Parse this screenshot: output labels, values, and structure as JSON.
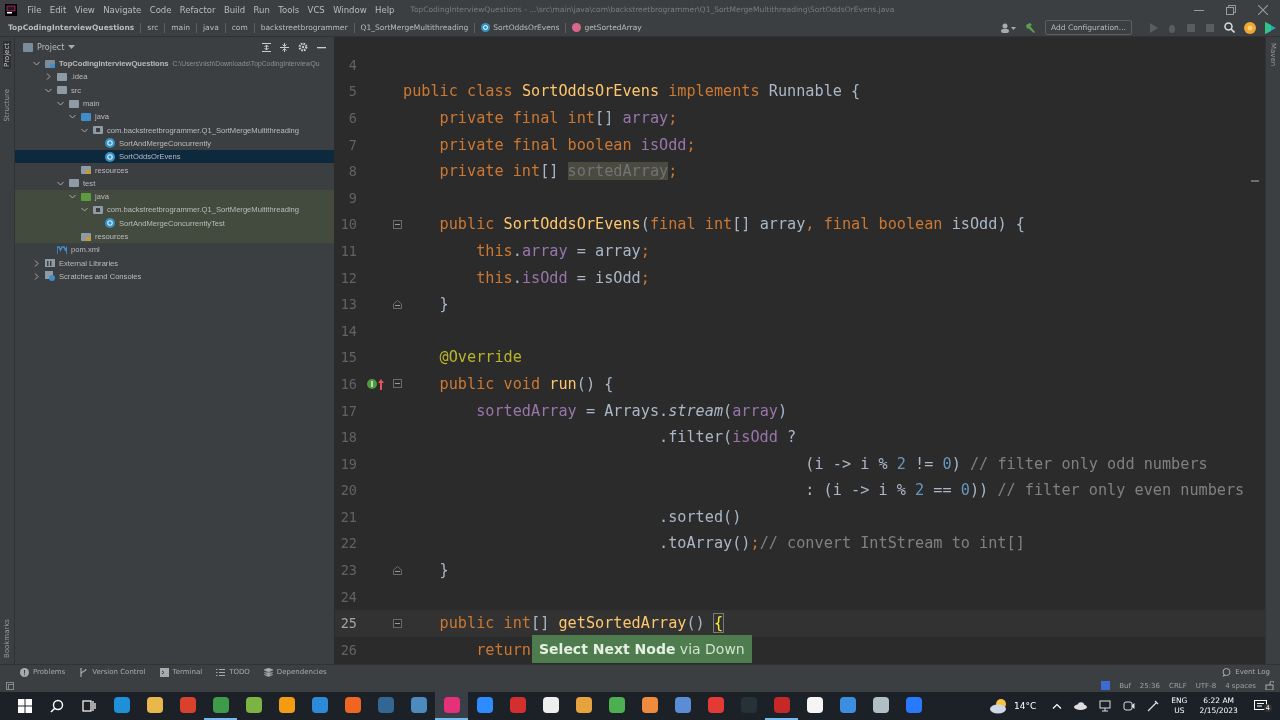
{
  "menu": [
    "File",
    "Edit",
    "View",
    "Navigate",
    "Code",
    "Refactor",
    "Build",
    "Run",
    "Tools",
    "VCS",
    "Window",
    "Help"
  ],
  "window": {
    "title": "TopCodingInterviewQuestions - ...\\src\\main\\java\\com\\backstreetbrogrammer\\Q1_SortMergeMultithreading\\SortOddsOrEvens.java"
  },
  "breadcrumbs": [
    {
      "label": "TopCodingInterviewQuestions",
      "kind": "project"
    },
    {
      "label": "src",
      "kind": "folder"
    },
    {
      "label": "main",
      "kind": "folder"
    },
    {
      "label": "java",
      "kind": "folder"
    },
    {
      "label": "com",
      "kind": "folder"
    },
    {
      "label": "backstreetbrogrammer",
      "kind": "folder"
    },
    {
      "label": "Q1_SortMergeMultithreading",
      "kind": "folder"
    },
    {
      "label": "SortOddsOrEvens",
      "kind": "class"
    },
    {
      "label": "getSortedArray",
      "kind": "method"
    }
  ],
  "toolbar": {
    "run_config": "Add Configuration..."
  },
  "side_tabs": {
    "left_top": [
      {
        "label": "Project",
        "selected": true
      },
      {
        "label": "Structure",
        "selected": false
      }
    ],
    "left_bottom": [
      {
        "label": "Bookmarks",
        "selected": false
      }
    ],
    "right": [
      {
        "label": "Maven",
        "selected": false
      }
    ]
  },
  "project_panel": {
    "title": "Project",
    "tree": [
      {
        "label": "TopCodingInterviewQuestions",
        "path": "C:\\Users\\nish\\Downloads\\TopCodingInterviewQu",
        "kind": "module",
        "expanded": true,
        "selected": false,
        "highlighted": false,
        "children": [
          {
            "label": ".idea",
            "kind": "folder",
            "expanded": false,
            "selected": false,
            "highlighted": false
          },
          {
            "label": "src",
            "kind": "folder",
            "expanded": true,
            "selected": false,
            "highlighted": false,
            "children": [
              {
                "label": "main",
                "kind": "folder",
                "expanded": true,
                "selected": false,
                "highlighted": false,
                "children": [
                  {
                    "label": "java",
                    "kind": "source",
                    "expanded": true,
                    "selected": false,
                    "highlighted": false,
                    "children": [
                      {
                        "label": "com.backstreetbrogrammer.Q1_SortMergeMultithreading",
                        "kind": "package",
                        "expanded": true,
                        "selected": false,
                        "highlighted": false,
                        "children": [
                          {
                            "label": "SortAndMergeConcurrently",
                            "kind": "class",
                            "selected": false,
                            "highlighted": false
                          },
                          {
                            "label": "SortOddsOrEvens",
                            "kind": "class",
                            "selected": true,
                            "highlighted": false
                          }
                        ]
                      }
                    ]
                  },
                  {
                    "label": "resources",
                    "kind": "resources",
                    "selected": false,
                    "highlighted": false
                  }
                ]
              },
              {
                "label": "test",
                "kind": "folder",
                "expanded": true,
                "selected": false,
                "highlighted": false,
                "children": [
                  {
                    "label": "java",
                    "kind": "test-source",
                    "expanded": true,
                    "selected": false,
                    "highlighted": true,
                    "children": [
                      {
                        "label": "com.backstreetbrogrammer.Q1_SortMergeMultithreading",
                        "kind": "package",
                        "expanded": true,
                        "selected": false,
                        "highlighted": true,
                        "children": [
                          {
                            "label": "SortAndMergeConcurrentlyTest",
                            "kind": "class",
                            "selected": false,
                            "highlighted": true
                          }
                        ]
                      }
                    ]
                  },
                  {
                    "label": "resources",
                    "kind": "resources",
                    "selected": false,
                    "highlighted": true
                  }
                ]
              }
            ]
          },
          {
            "label": "pom.xml",
            "kind": "maven",
            "selected": false,
            "highlighted": false
          }
        ]
      },
      {
        "label": "External Libraries",
        "kind": "library",
        "expanded": false,
        "selected": false,
        "highlighted": false
      },
      {
        "label": "Scratches and Consoles",
        "kind": "scratches",
        "expanded": false,
        "selected": false,
        "highlighted": false
      }
    ]
  },
  "editor": {
    "lines": [
      {
        "number": "4",
        "current": false,
        "override": false
      },
      {
        "number": "5",
        "current": false,
        "override": false,
        "tokens": [
          {
            "kind": "keyword",
            "text": "public class "
          },
          {
            "kind": "declaration",
            "text": "SortOddsOrEvens "
          },
          {
            "kind": "keyword",
            "text": "implements "
          },
          {
            "kind": "plain",
            "text": "Runnable {"
          }
        ]
      },
      {
        "number": "6",
        "current": false,
        "override": false,
        "tokens": [
          {
            "kind": "keyword",
            "text": "    private final int"
          },
          {
            "kind": "plain",
            "text": "[] "
          },
          {
            "kind": "field",
            "text": "array"
          },
          {
            "kind": "keyword",
            "text": ";"
          }
        ]
      },
      {
        "number": "7",
        "current": false,
        "override": false,
        "tokens": [
          {
            "kind": "keyword",
            "text": "    private final boolean "
          },
          {
            "kind": "field",
            "text": "isOdd"
          },
          {
            "kind": "keyword",
            "text": ";"
          }
        ]
      },
      {
        "number": "8",
        "current": false,
        "override": false,
        "tokens": [
          {
            "kind": "keyword",
            "text": "    private int"
          },
          {
            "kind": "plain",
            "text": "[] "
          },
          {
            "kind": "unused",
            "text": "sortedArray"
          },
          {
            "kind": "keyword",
            "text": ";"
          }
        ]
      },
      {
        "number": "9",
        "current": false,
        "override": false
      },
      {
        "number": "10",
        "current": false,
        "override": false,
        "fold_start": true,
        "tokens": [
          {
            "kind": "keyword",
            "text": "    public "
          },
          {
            "kind": "declaration",
            "text": "SortOddsOrEvens"
          },
          {
            "kind": "plain",
            "text": "("
          },
          {
            "kind": "keyword",
            "text": "final int"
          },
          {
            "kind": "plain",
            "text": "[] array"
          },
          {
            "kind": "keyword",
            "text": ", final boolean "
          },
          {
            "kind": "plain",
            "text": "isOdd) {"
          }
        ]
      },
      {
        "number": "11",
        "current": false,
        "override": false,
        "tokens": [
          {
            "kind": "keyword",
            "text": "        this"
          },
          {
            "kind": "plain",
            "text": "."
          },
          {
            "kind": "field",
            "text": "array"
          },
          {
            "kind": "plain",
            "text": " = array"
          },
          {
            "kind": "keyword",
            "text": ";"
          }
        ]
      },
      {
        "number": "12",
        "current": false,
        "override": false,
        "tokens": [
          {
            "kind": "keyword",
            "text": "        this"
          },
          {
            "kind": "plain",
            "text": "."
          },
          {
            "kind": "field",
            "text": "isOdd"
          },
          {
            "kind": "plain",
            "text": " = isOdd"
          },
          {
            "kind": "keyword",
            "text": ";"
          }
        ]
      },
      {
        "number": "13",
        "current": false,
        "override": false,
        "fold_end": true,
        "tokens": [
          {
            "kind": "plain",
            "text": "    }"
          }
        ]
      },
      {
        "number": "14",
        "current": false,
        "override": false
      },
      {
        "number": "15",
        "current": false,
        "override": false,
        "tokens": [
          {
            "kind": "annotation",
            "text": "    @Override"
          }
        ]
      },
      {
        "number": "16",
        "current": false,
        "override": true,
        "fold_start": true,
        "tokens": [
          {
            "kind": "keyword",
            "text": "    public void "
          },
          {
            "kind": "declaration",
            "text": "run"
          },
          {
            "kind": "plain",
            "text": "() {"
          }
        ]
      },
      {
        "number": "17",
        "current": false,
        "override": false,
        "tokens": [
          {
            "kind": "field",
            "text": "        sortedArray"
          },
          {
            "kind": "plain",
            "text": " = Arrays."
          },
          {
            "kind": "static",
            "text": "stream"
          },
          {
            "kind": "plain",
            "text": "("
          },
          {
            "kind": "field",
            "text": "array"
          },
          {
            "kind": "plain",
            "text": ")"
          }
        ]
      },
      {
        "number": "18",
        "current": false,
        "override": false,
        "tokens": [
          {
            "kind": "plain",
            "text": "                            .filter("
          },
          {
            "kind": "field",
            "text": "isOdd"
          },
          {
            "kind": "plain",
            "text": " ?"
          }
        ]
      },
      {
        "number": "19",
        "current": false,
        "override": false,
        "tokens": [
          {
            "kind": "plain",
            "text": "                                            (i -> i % "
          },
          {
            "kind": "number",
            "text": "2"
          },
          {
            "kind": "plain",
            "text": " != "
          },
          {
            "kind": "number",
            "text": "0"
          },
          {
            "kind": "plain",
            "text": ") "
          },
          {
            "kind": "comment",
            "text": "// filter only odd numbers"
          }
        ]
      },
      {
        "number": "20",
        "current": false,
        "override": false,
        "tokens": [
          {
            "kind": "plain",
            "text": "                                            : (i -> i % "
          },
          {
            "kind": "number",
            "text": "2"
          },
          {
            "kind": "plain",
            "text": " == "
          },
          {
            "kind": "number",
            "text": "0"
          },
          {
            "kind": "plain",
            "text": ")) "
          },
          {
            "kind": "comment",
            "text": "// filter only even numbers"
          }
        ]
      },
      {
        "number": "21",
        "current": false,
        "override": false,
        "tokens": [
          {
            "kind": "plain",
            "text": "                            .sorted()"
          }
        ]
      },
      {
        "number": "22",
        "current": false,
        "override": false,
        "tokens": [
          {
            "kind": "plain",
            "text": "                            .toArray()"
          },
          {
            "kind": "keyword",
            "text": ";"
          },
          {
            "kind": "comment",
            "text": "// convert IntStream to int[]"
          }
        ]
      },
      {
        "number": "23",
        "current": false,
        "override": false,
        "fold_end": true,
        "tokens": [
          {
            "kind": "plain",
            "text": "    }"
          }
        ]
      },
      {
        "number": "24",
        "current": false,
        "override": false
      },
      {
        "number": "25",
        "current": true,
        "override": false,
        "fold_start": true,
        "tokens": [
          {
            "kind": "keyword",
            "text": "    public int"
          },
          {
            "kind": "plain",
            "text": "[] "
          },
          {
            "kind": "declaration",
            "text": "getSortedArray"
          },
          {
            "kind": "plain",
            "text": "() "
          },
          {
            "kind": "brace",
            "text": "{"
          }
        ]
      },
      {
        "number": "26",
        "current": false,
        "override": false,
        "tokens": [
          {
            "kind": "keyword",
            "text": "        return"
          }
        ]
      }
    ],
    "tooltip": "**Select Next Node** via Down"
  },
  "tool_tabs": [
    {
      "label": "Problems",
      "kind": "problems"
    },
    {
      "label": "Version Control",
      "kind": "vcs"
    },
    {
      "label": "Terminal",
      "kind": "terminal"
    },
    {
      "label": "TODO",
      "kind": "todo"
    },
    {
      "label": "Dependencies",
      "kind": "deps"
    }
  ],
  "event_log": "Event Log",
  "status_bar": [
    "Buf",
    "25:36",
    "CRLF",
    "UTF-8",
    "4 spaces"
  ],
  "taskbar": {
    "apps": [
      {
        "color": "#1f8fd8",
        "selected": false,
        "running": false
      },
      {
        "color": "#e8b84a",
        "selected": false,
        "running": false
      },
      {
        "color": "#d9412c",
        "selected": false,
        "running": false
      },
      {
        "color": "#3e9b4a",
        "selected": false,
        "running": true
      },
      {
        "color": "#7cb342",
        "selected": false,
        "running": false
      },
      {
        "color": "#f39c12",
        "selected": false,
        "running": false
      },
      {
        "color": "#2d8ad8",
        "selected": false,
        "running": false
      },
      {
        "color": "#f06522",
        "selected": false,
        "running": false
      },
      {
        "color": "#336791",
        "selected": false,
        "running": false
      },
      {
        "color": "#4b8bbe",
        "selected": false,
        "running": false
      },
      {
        "color": "#e5317a",
        "selected": true,
        "running": true
      },
      {
        "color": "#2d8cff",
        "selected": false,
        "running": false
      },
      {
        "color": "#d32f2f",
        "selected": false,
        "running": false
      },
      {
        "color": "#eeeeee",
        "selected": false,
        "running": false
      },
      {
        "color": "#e6a23c",
        "selected": false,
        "running": false
      },
      {
        "color": "#4caf50",
        "selected": false,
        "running": false
      },
      {
        "color": "#f08a3c",
        "selected": false,
        "running": false
      },
      {
        "color": "#5b8dd6",
        "selected": false,
        "running": false
      },
      {
        "color": "#e53935",
        "selected": false,
        "running": false
      },
      {
        "color": "#263238",
        "selected": false,
        "running": false
      },
      {
        "color": "#c62828",
        "selected": false,
        "running": true
      },
      {
        "color": "#f5f5f5",
        "selected": false,
        "running": false
      },
      {
        "color": "#3d8ee0",
        "selected": false,
        "running": false
      },
      {
        "color": "#b0bec5",
        "selected": false,
        "running": false
      },
      {
        "color": "#2979ff",
        "selected": false,
        "running": false
      }
    ],
    "temperature": "14°C",
    "language": "ENG",
    "layout": "US",
    "time": "6:22 AM",
    "date": "2/15/2023",
    "notifications": "4"
  }
}
